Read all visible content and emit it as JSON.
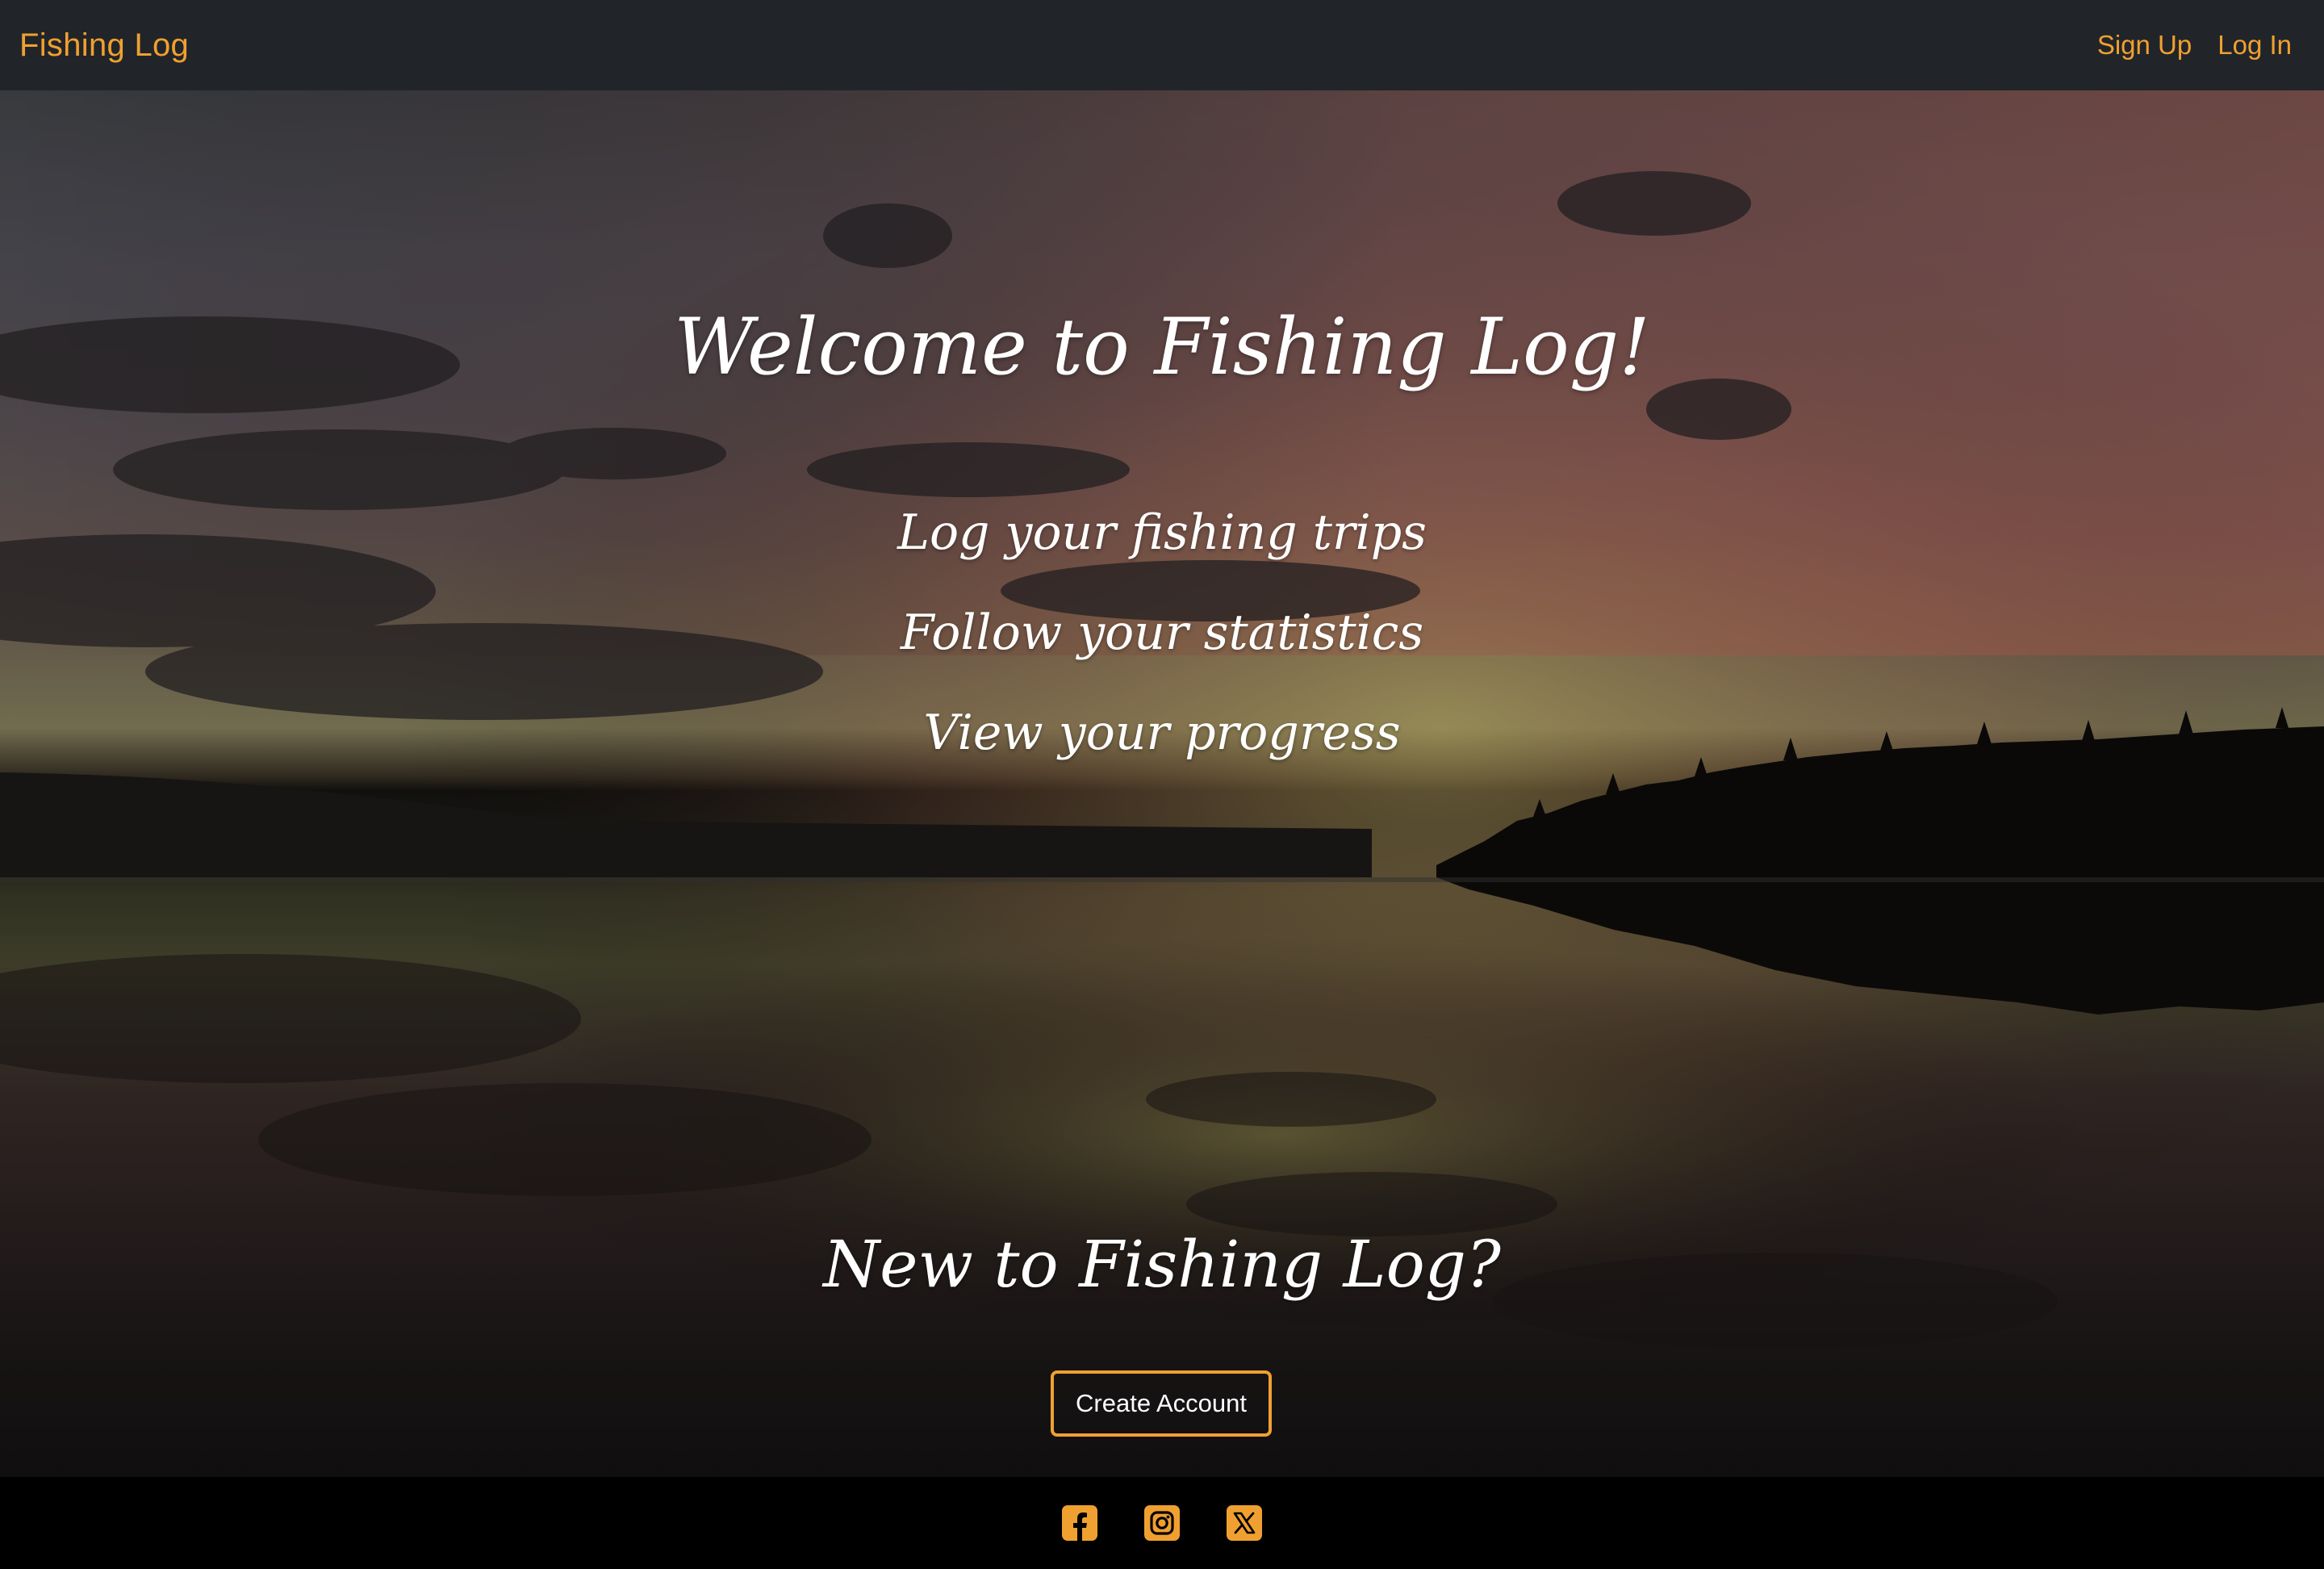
{
  "navbar": {
    "brand": "Fishing Log",
    "links": [
      {
        "label": "Sign Up"
      },
      {
        "label": "Log In"
      }
    ]
  },
  "hero": {
    "title": "Welcome to Fishing Log!",
    "features": [
      "Log your fishing trips",
      "Follow your statistics",
      "View your progress"
    ],
    "cta_heading": "New to Fishing Log?",
    "cta_button": "Create Account",
    "background_image": "sunset-over-lake-reflection"
  },
  "footer": {
    "social_icons": [
      "facebook-icon",
      "instagram-icon",
      "x-twitter-icon"
    ]
  },
  "colors": {
    "accent": "#f0a030",
    "navbar_bg": "#212529",
    "footer_bg": "#000000",
    "text": "#ffffff"
  }
}
